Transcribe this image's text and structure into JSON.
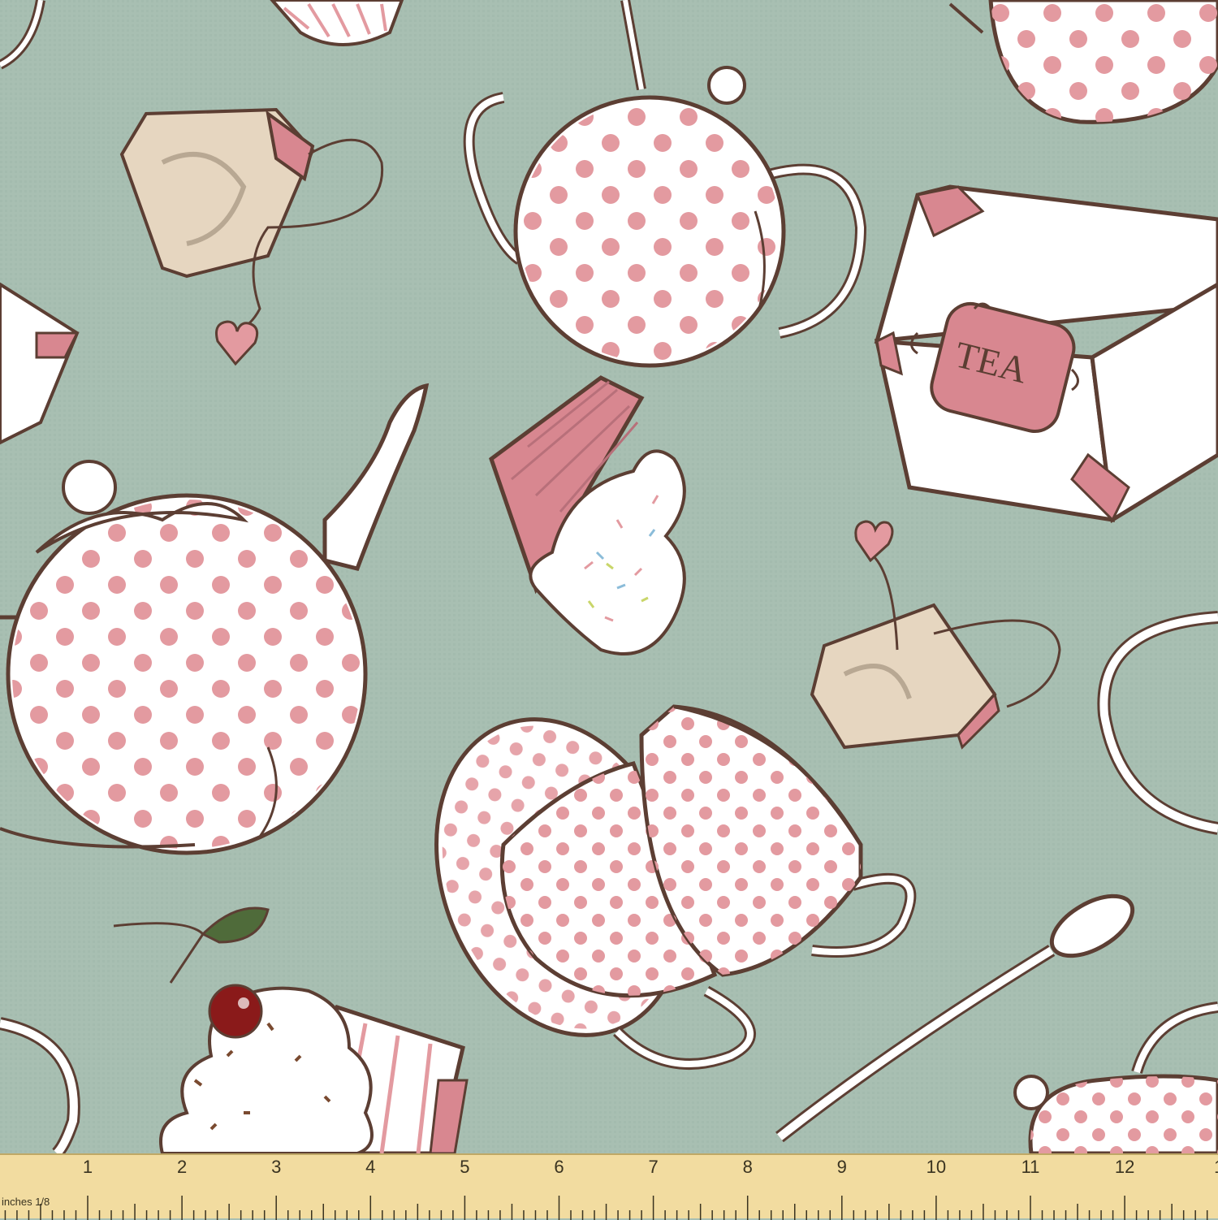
{
  "colors": {
    "background": "#a8bfb2",
    "outline": "#5c3e33",
    "porcelain": "#ffffff",
    "polka_dot": "#e39aa0",
    "pink_wrapper": "#d88790",
    "teabag": "#e6d6c0",
    "cherry": "#8a1a1a",
    "leaf": "#4f6b3a",
    "ruler": "#f2dca0"
  },
  "labels": {
    "tea_tin": "TEA"
  },
  "ruler": {
    "caption": "inches 1/8",
    "numbers": [
      "1",
      "2",
      "3",
      "4",
      "5",
      "6",
      "7",
      "8",
      "9",
      "10",
      "11",
      "12",
      "1"
    ]
  },
  "icons": [
    "teapot-icon",
    "teacup-icon",
    "saucer-icon",
    "spoon-icon",
    "teabag-icon",
    "cupcake-icon",
    "tea-tin-icon",
    "heart-tag-icon",
    "cherry-icon"
  ]
}
